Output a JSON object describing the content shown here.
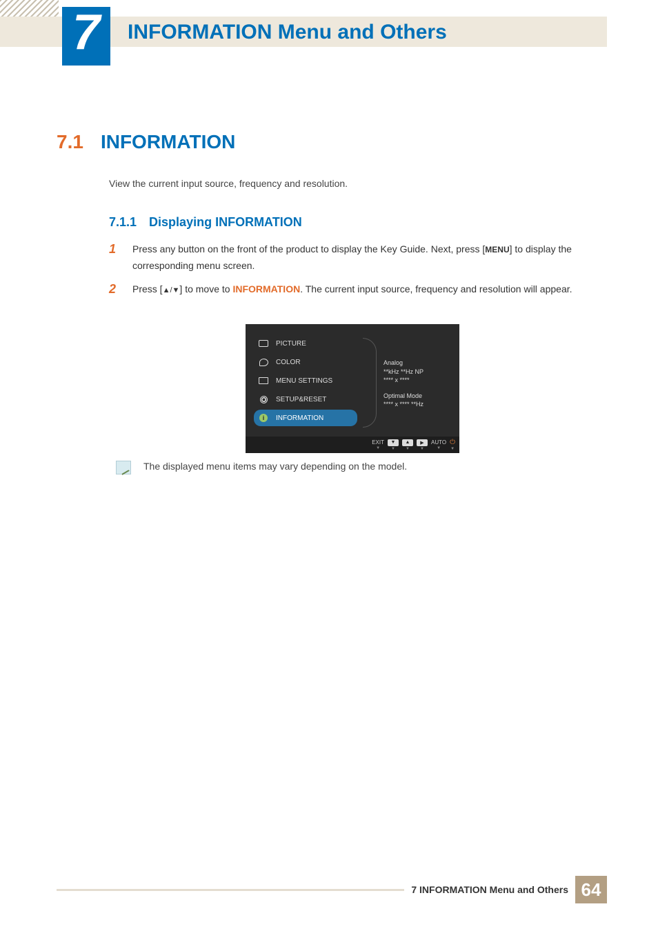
{
  "chapter": {
    "number": "7",
    "title": "INFORMATION Menu and Others"
  },
  "section": {
    "number": "7.1",
    "title": "INFORMATION"
  },
  "intro": "View the current input source, frequency and resolution.",
  "subsection": {
    "number": "7.1.1",
    "title": "Displaying INFORMATION"
  },
  "steps": [
    {
      "num": "1",
      "pre": "Press any button on the front of the product to display the Key Guide. Next, press [",
      "key": "MENU",
      "post": "] to display the corresponding menu screen."
    },
    {
      "num": "2",
      "pre": "Press [",
      "arrowA": "▲",
      "sep": "/",
      "arrowB": "▼",
      "mid1": "] to move to ",
      "highlight": "INFORMATION",
      "mid2": ".",
      "tail": " The current input source, frequency and resolution will appear."
    }
  ],
  "osd": {
    "menu": [
      "PICTURE",
      "COLOR",
      "MENU SETTINGS",
      "SETUP&RESET",
      "INFORMATION"
    ],
    "selected": "INFORMATION",
    "info": {
      "l1": "Analog",
      "l2": "**kHz **Hz NP",
      "l3": "**** x ****",
      "l4": "Optimal Mode",
      "l5": "**** x ****  **Hz"
    },
    "footer": {
      "exit": "EXIT",
      "auto": "AUTO"
    }
  },
  "note": "The displayed menu items may vary depending on the model.",
  "footer": {
    "label": "7 INFORMATION Menu and Others",
    "page": "64"
  }
}
